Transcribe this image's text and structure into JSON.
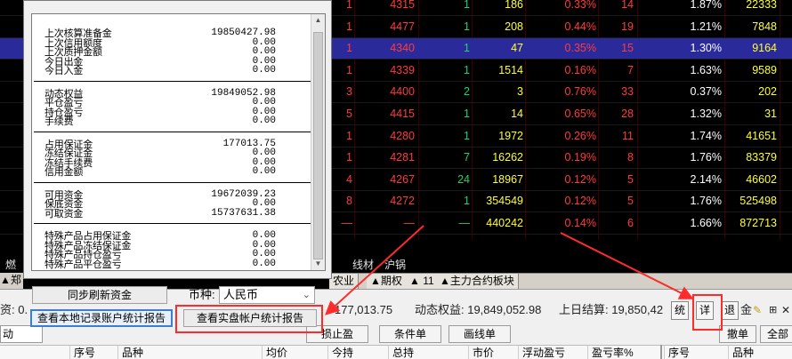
{
  "market": {
    "rows": [
      {
        "seq": "1",
        "price": "4315",
        "vol": "1",
        "total": "186",
        "pct": "0.33%",
        "n": "14",
        "rate": "1.87%",
        "amt": "22333",
        "price_color": "red",
        "vol_color": "green",
        "pct_color": "red"
      },
      {
        "seq": "1",
        "price": "4477",
        "vol": "1",
        "total": "208",
        "pct": "0.44%",
        "n": "19",
        "rate": "1.21%",
        "amt": "7848",
        "price_color": "red",
        "vol_color": "green",
        "pct_color": "red"
      },
      {
        "seq": "1",
        "price": "4340",
        "vol": "1",
        "total": "47",
        "pct": "0.35%",
        "n": "15",
        "rate": "1.30%",
        "amt": "9164",
        "price_color": "red",
        "vol_color": "green",
        "pct_color": "red",
        "selected": true
      },
      {
        "seq": "1",
        "price": "4339",
        "vol": "1",
        "total": "1514",
        "pct": "0.16%",
        "n": "7",
        "rate": "1.63%",
        "amt": "9589",
        "price_color": "red",
        "vol_color": "green",
        "pct_color": "red"
      },
      {
        "seq": "3",
        "price": "4400",
        "vol": "2",
        "total": "3",
        "pct": "0.76%",
        "n": "33",
        "rate": "0.37%",
        "amt": "202",
        "price_color": "red",
        "vol_color": "green",
        "pct_color": "red"
      },
      {
        "seq": "5",
        "price": "4415",
        "vol": "1",
        "total": "14",
        "pct": "0.65%",
        "n": "28",
        "rate": "1.32%",
        "amt": "31",
        "price_color": "red",
        "vol_color": "green",
        "pct_color": "red"
      },
      {
        "seq": "1",
        "price": "4280",
        "vol": "1",
        "total": "1972",
        "pct": "0.26%",
        "n": "11",
        "rate": "1.74%",
        "amt": "41651",
        "price_color": "red",
        "vol_color": "green",
        "pct_color": "red"
      },
      {
        "seq": "1",
        "price": "4281",
        "vol": "7",
        "total": "16262",
        "pct": "0.19%",
        "n": "8",
        "rate": "1.76%",
        "amt": "83379",
        "price_color": "red",
        "vol_color": "green",
        "pct_color": "red"
      },
      {
        "seq": "4",
        "price": "4267",
        "vol": "24",
        "total": "18967",
        "pct": "0.12%",
        "n": "5",
        "rate": "2.14%",
        "amt": "46602",
        "price_color": "red",
        "vol_color": "green",
        "pct_color": "red"
      },
      {
        "seq": "8",
        "price": "4272",
        "vol": "1",
        "total": "354549",
        "pct": "0.12%",
        "n": "5",
        "rate": "1.76%",
        "amt": "525498",
        "price_color": "red",
        "vol_color": "green",
        "pct_color": "red"
      },
      {
        "seq": "—",
        "price": "—",
        "vol": "—",
        "total": "440242",
        "pct": "0.14%",
        "n": "6",
        "rate": "1.66%",
        "amt": "872713",
        "price_color": "white",
        "vol_color": "green",
        "pct_color": "red"
      }
    ],
    "left_row_label": "▲郑",
    "left_label2": "燃",
    "sub_tabs": [
      "线材",
      "沪锅"
    ],
    "bottom_tabs": [
      "农业",
      "▲期权",
      "▲ 11",
      "▲主力合约板块"
    ]
  },
  "popup": {
    "sections": [
      [
        {
          "label": "上次核算准备金",
          "value": "19850427.98"
        },
        {
          "label": "上次信用额度",
          "value": "0.00"
        },
        {
          "label": "上次质押金额",
          "value": "0.00"
        },
        {
          "label": "今日出金",
          "value": "0.00"
        },
        {
          "label": "今日入金",
          "value": "0.00"
        }
      ],
      [
        {
          "label": "动态权益",
          "value": "19849052.98"
        },
        {
          "label": "平仓盈亏",
          "value": "0.00"
        },
        {
          "label": "持仓盈亏",
          "value": "0.00"
        },
        {
          "label": "手续费",
          "value": "0.00"
        }
      ],
      [
        {
          "label": "占用保证金",
          "value": "177013.75"
        },
        {
          "label": "冻结保证金",
          "value": "0.00"
        },
        {
          "label": "冻结手续费",
          "value": "0.00"
        },
        {
          "label": "信用金额",
          "value": "0.00"
        }
      ],
      [
        {
          "label": "可用资金",
          "value": "19672039.23"
        },
        {
          "label": "保底资金",
          "value": "0.00"
        },
        {
          "label": "可取资金",
          "value": "15737631.38"
        }
      ],
      [
        {
          "label": "特殊产品占用保证金",
          "value": "0.00"
        },
        {
          "label": "特殊产品冻结保证金",
          "value": "0.00"
        },
        {
          "label": "特殊产品持仓盈亏",
          "value": "0.00"
        },
        {
          "label": "特殊产品平仓盈亏",
          "value": "0.00"
        }
      ]
    ],
    "sync_button": "同步刷新资金",
    "currency_label": "币种:",
    "currency_value": "人民币",
    "local_report_button": "查看本地记录账户统计报告",
    "real_report_button": "查看实盘帐户统计报告"
  },
  "status": {
    "left_fragment": "资: 0.",
    "margin_fragment": "177,013.75",
    "dynamic_equity": "动态权益: 19,849,052.98",
    "last_settlement": "上日结算: 19,850,42",
    "btn_stat": "统",
    "btn_detail": "详",
    "btn_exit": "退",
    "right_fragment": "金"
  },
  "toolbar": {
    "left_label": "动",
    "stop_loss": "损止盈",
    "condition_order": "条件单",
    "line_order": "画线单",
    "cancel": "撤单",
    "all": "全部"
  },
  "positions_header": [
    "序号",
    "品种",
    "均价",
    "今持",
    "总持",
    "市价",
    "浮动盈亏",
    "盈亏率%"
  ],
  "orders_header": [
    "序号",
    "品种"
  ],
  "colors": {
    "red": "#ff3b3b",
    "green": "#21d36b",
    "annotation": "#ff2a2a",
    "selected_row": "#2a2a9a"
  }
}
